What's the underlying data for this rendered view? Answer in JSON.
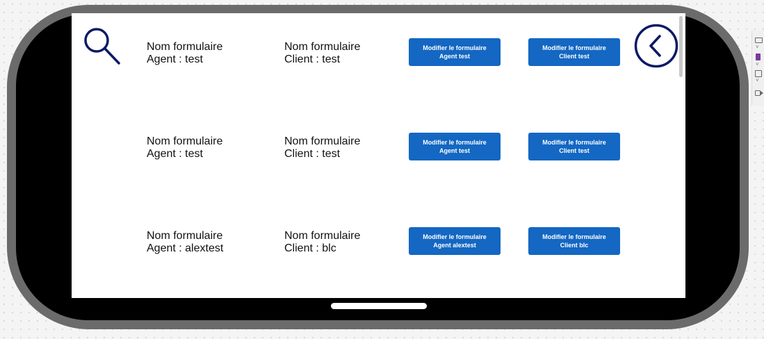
{
  "rows": [
    {
      "agent_title": "Nom formulaire",
      "agent_value": "Agent : test",
      "client_title": "Nom formulaire",
      "client_value": "Client : test",
      "agent_button": {
        "line1": "Modifier le formulaire",
        "line2": "Agent test"
      },
      "client_button": {
        "line1": "Modifier le formulaire",
        "line2": "Client test"
      }
    },
    {
      "agent_title": "Nom formulaire",
      "agent_value": "Agent : test",
      "client_title": "Nom formulaire",
      "client_value": "Client : test",
      "agent_button": {
        "line1": "Modifier le formulaire",
        "line2": "Agent test"
      },
      "client_button": {
        "line1": "Modifier le formulaire",
        "line2": "Client test"
      }
    },
    {
      "agent_title": "Nom formulaire",
      "agent_value": "Agent : alextest",
      "client_title": "Nom formulaire",
      "client_value": "Client : blc",
      "agent_button": {
        "line1": "Modifier le formulaire",
        "line2": "Agent alextest"
      },
      "client_button": {
        "line1": "Modifier le formulaire",
        "line2": "Client blc"
      }
    }
  ],
  "icons": {
    "search": "search-icon",
    "back": "chevron-left-circle-icon"
  },
  "colors": {
    "button_bg": "#1467c2",
    "button_text": "#ffffff",
    "icon_navy": "#0b1a66",
    "frame": "#6b6b6b",
    "screen_bg": "#ffffff"
  }
}
